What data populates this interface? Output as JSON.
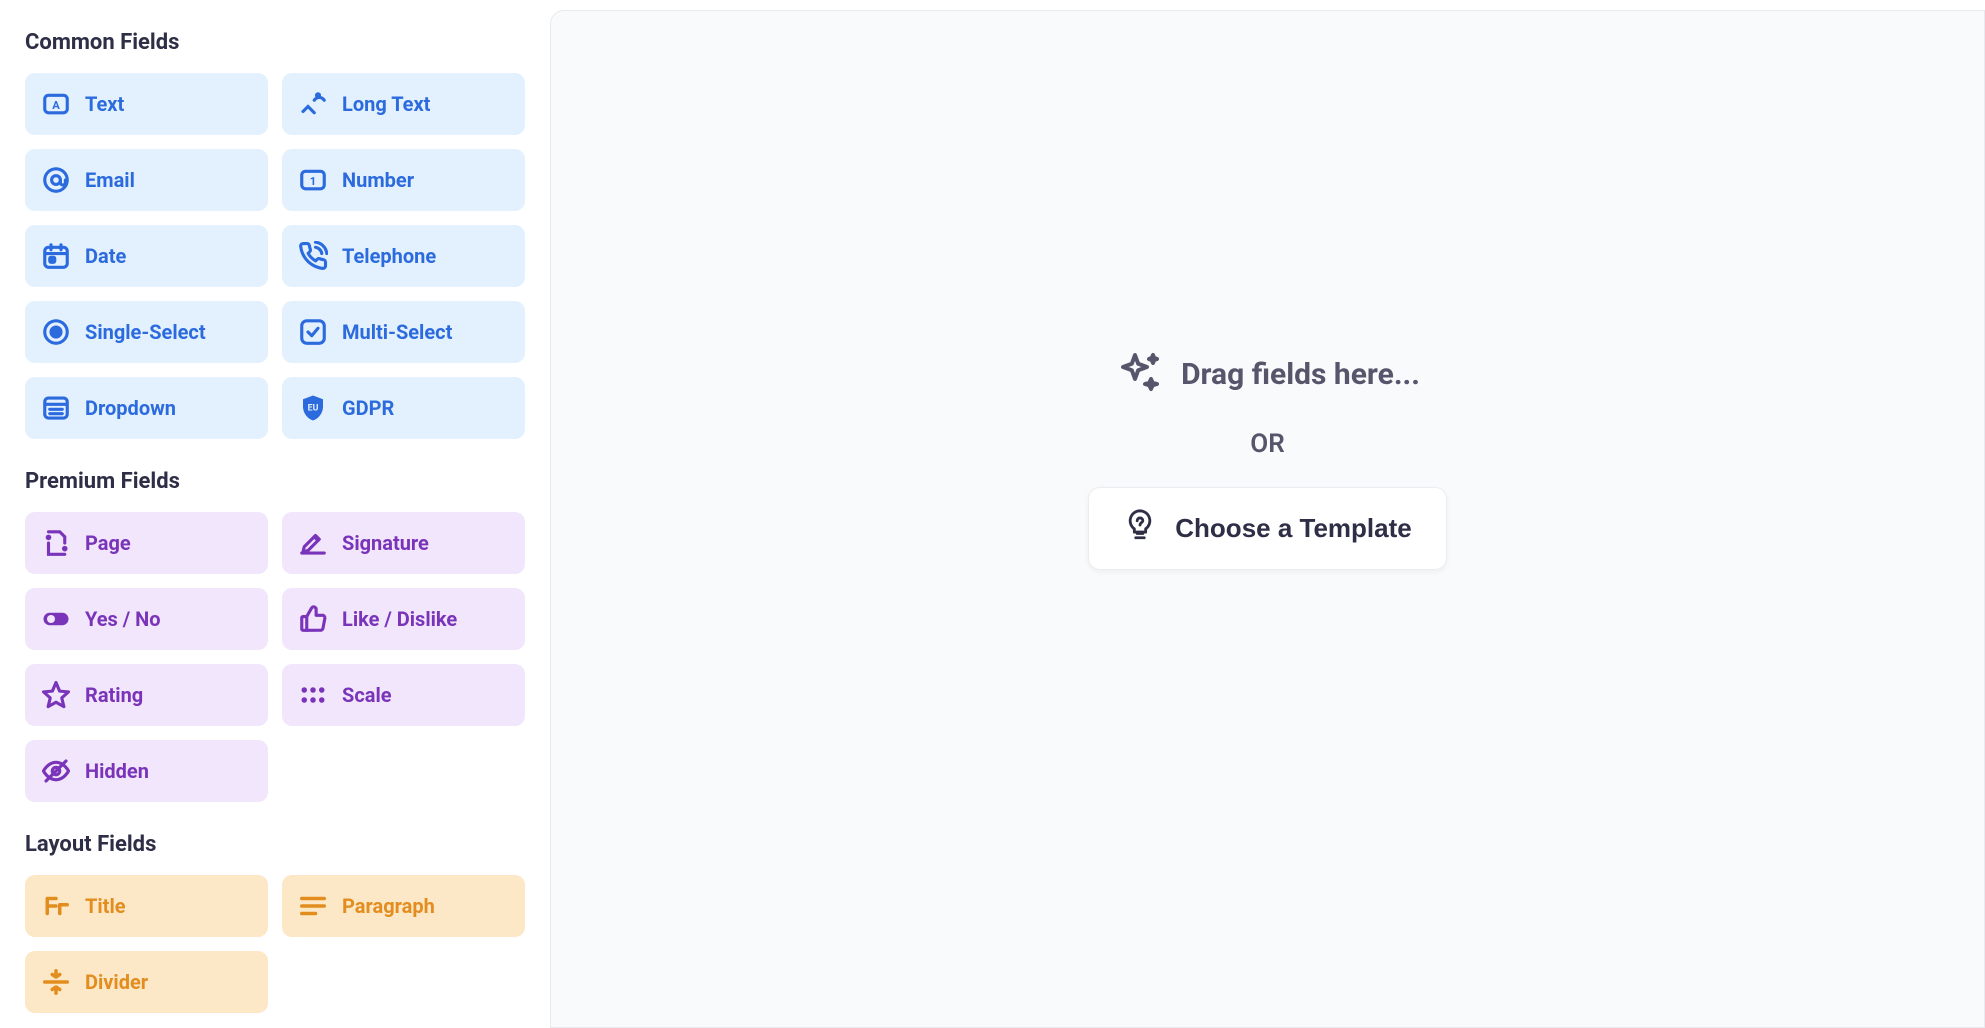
{
  "sidebar": {
    "sections": {
      "common": {
        "heading": "Common Fields",
        "items": [
          {
            "label": "Text"
          },
          {
            "label": "Long Text"
          },
          {
            "label": "Email"
          },
          {
            "label": "Number"
          },
          {
            "label": "Date"
          },
          {
            "label": "Telephone"
          },
          {
            "label": "Single-Select"
          },
          {
            "label": "Multi-Select"
          },
          {
            "label": "Dropdown"
          },
          {
            "label": "GDPR"
          }
        ]
      },
      "premium": {
        "heading": "Premium Fields",
        "items": [
          {
            "label": "Page"
          },
          {
            "label": "Signature"
          },
          {
            "label": "Yes / No"
          },
          {
            "label": "Like / Dislike"
          },
          {
            "label": "Rating"
          },
          {
            "label": "Scale"
          },
          {
            "label": "Hidden"
          }
        ]
      },
      "layout": {
        "heading": "Layout Fields",
        "items": [
          {
            "label": "Title"
          },
          {
            "label": "Paragraph"
          },
          {
            "label": "Divider"
          }
        ]
      }
    }
  },
  "main": {
    "drag_text": "Drag fields here...",
    "or_text": "OR",
    "template_btn": "Choose a Template"
  }
}
